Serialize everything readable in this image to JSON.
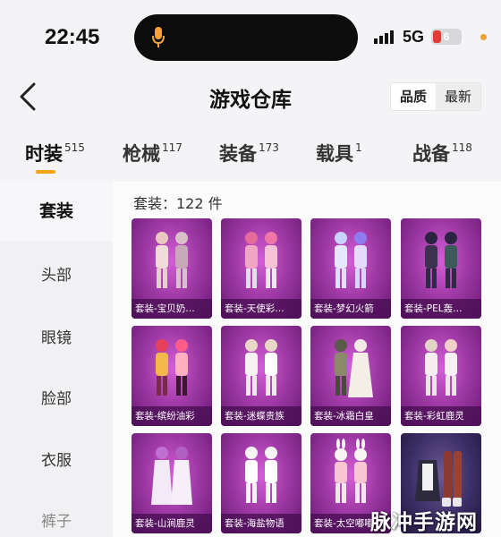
{
  "status": {
    "time": "22:45",
    "network": "5G",
    "battery": "6"
  },
  "header": {
    "title": "游戏仓库",
    "sort": [
      "品质",
      "最新"
    ]
  },
  "tabs": [
    {
      "label": "时装",
      "count": "515"
    },
    {
      "label": "枪械",
      "count": "117"
    },
    {
      "label": "装备",
      "count": "173"
    },
    {
      "label": "载具",
      "count": "1"
    },
    {
      "label": "战备",
      "count": "118"
    }
  ],
  "sidebar": [
    "套装",
    "头部",
    "眼镜",
    "脸部",
    "衣服",
    "裤子"
  ],
  "section": {
    "title": "套装：122 件"
  },
  "items": [
    {
      "name": "套装-宝贝奶…"
    },
    {
      "name": "套装-天使彩…"
    },
    {
      "name": "套装-梦幻火箭"
    },
    {
      "name": "套装-PEL轰…"
    },
    {
      "name": "套装-缤纷油彩"
    },
    {
      "name": "套装-迷蝶贵族"
    },
    {
      "name": "套装-冰霜白皇"
    },
    {
      "name": "套装-彩虹鹿灵"
    },
    {
      "name": "套装-山涧鹿灵"
    },
    {
      "name": "套装-海盐物语"
    },
    {
      "name": "套装-太空嘟嘟"
    },
    {
      "name": ""
    }
  ],
  "watermark": "脉冲手游网",
  "colors": {
    "accent": "#f2a712",
    "card": "#a03aa6",
    "battery_low": "#e23b35"
  }
}
